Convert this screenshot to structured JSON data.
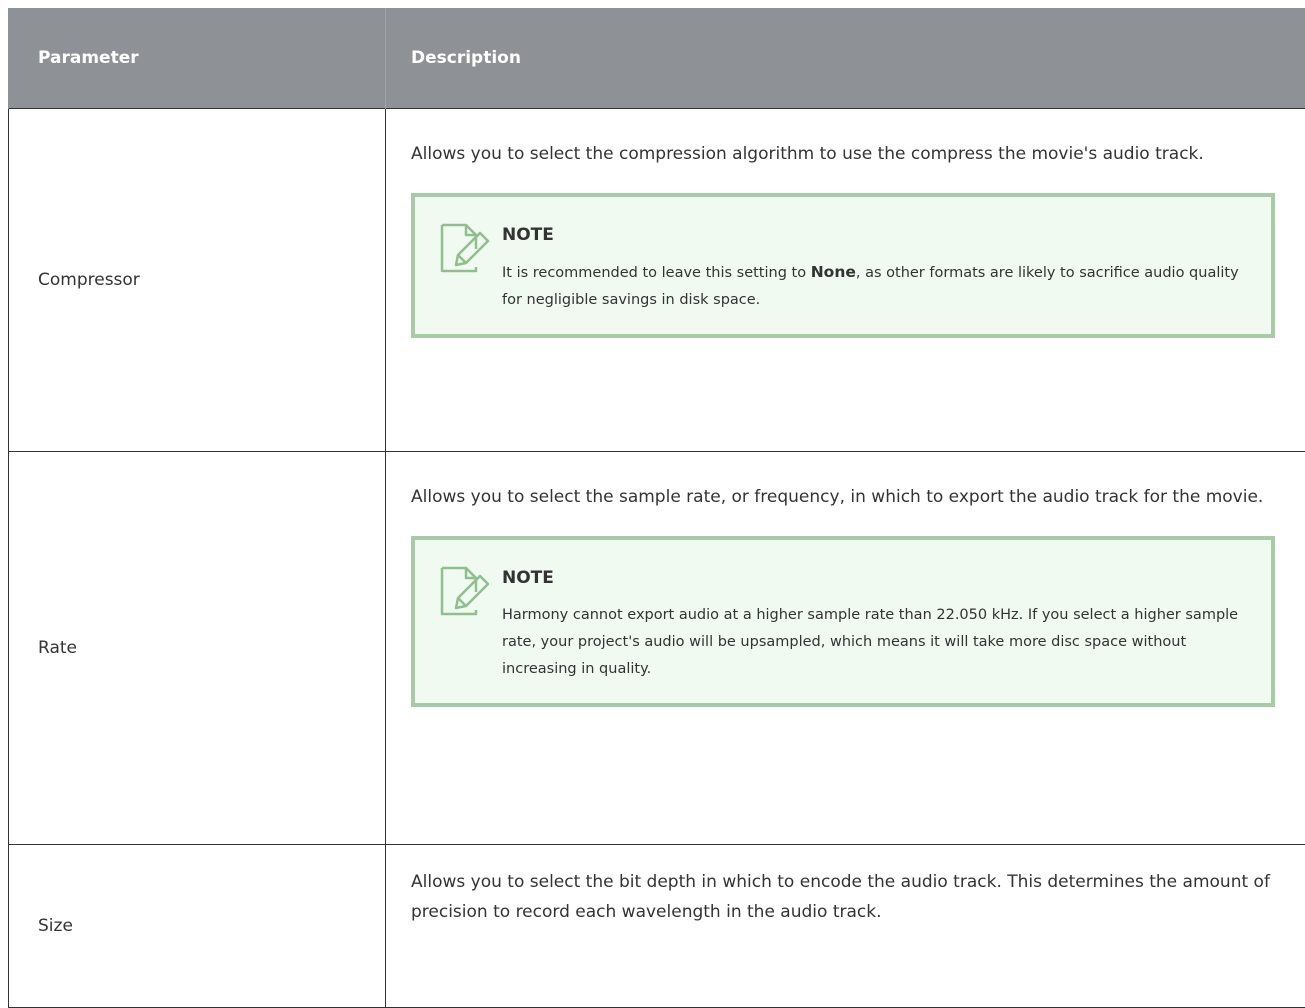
{
  "table": {
    "headers": {
      "parameter": "Parameter",
      "description": "Description"
    },
    "rows": [
      {
        "parameter": "Compressor",
        "description": "Allows you to select the compression algorithm to use the compress the movie's audio track.",
        "note": {
          "title": "NOTE",
          "text_before": "It is recommended to leave this setting to ",
          "bold": "None",
          "text_after": ", as other formats are likely to sacrifice audio quality for negligible savings in disk space.",
          "icon": "note-pencil-icon"
        }
      },
      {
        "parameter": "Rate",
        "description": "Allows you to select the sample rate, or frequency, in which to export the audio track for the movie.",
        "note": {
          "title": "NOTE",
          "text": "Harmony cannot export audio at a higher sample rate than 22.050 kHz. If you select a higher sample rate, your project's audio will be upsampled, which means it will take more disc space without increasing in quality.",
          "icon": "note-pencil-icon"
        }
      },
      {
        "parameter": "Size",
        "description": "Allows you to select the bit depth in which to encode the audio track. This determines the amount of precision to record each wavelength in the audio track."
      }
    ]
  },
  "colors": {
    "header_bg": "#8e9196",
    "header_text": "#ffffff",
    "note_border": "#a7cba5",
    "note_bg": "#f1faf0",
    "icon_stroke": "#8fbf8c"
  }
}
